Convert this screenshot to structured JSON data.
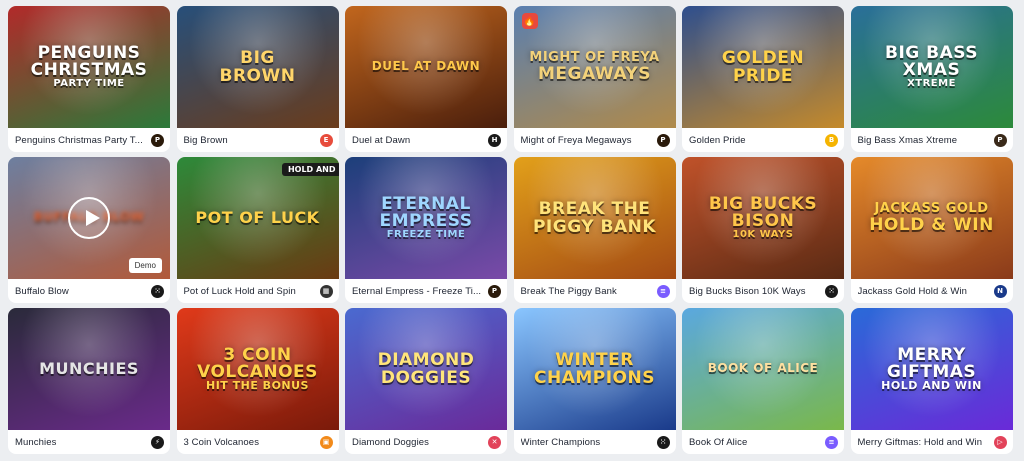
{
  "games": [
    {
      "title": "Penguins Christmas Party T...",
      "art": [
        "Penguins",
        "Christmas",
        "Party Time"
      ],
      "bg": [
        "#b22a2a",
        "#2b7a3a"
      ],
      "artColor": "#ffffff",
      "provider": {
        "icon": "play-n-go-icon",
        "glyph": "P",
        "color": "#2a1a0a"
      }
    },
    {
      "title": "Big Brown",
      "art": [
        "Big",
        "Brown"
      ],
      "bg": [
        "#274f7a",
        "#6a3c1c"
      ],
      "artColor": "#ffd56a",
      "provider": {
        "icon": "evoplay-icon",
        "glyph": "E",
        "color": "#e74c3c"
      }
    },
    {
      "title": "Duel at Dawn",
      "art": [
        "Duel at Dawn"
      ],
      "bg": [
        "#c1661d",
        "#4a1e0c"
      ],
      "artColor": "#ffc84a",
      "provider": {
        "icon": "hacksaw-icon",
        "glyph": "H",
        "color": "#1a1a1a"
      }
    },
    {
      "title": "Might of Freya Megaways",
      "art": [
        "Might of Freya",
        "Megaways"
      ],
      "bg": [
        "#5a7fb0",
        "#b08a4a"
      ],
      "artColor": "#f3d27a",
      "provider": {
        "icon": "play-n-go-icon",
        "glyph": "P",
        "color": "#2a1a0a"
      },
      "hot": "🔥"
    },
    {
      "title": "Golden Pride",
      "art": [
        "Golden",
        "Pride"
      ],
      "bg": [
        "#2e4f8e",
        "#c58a2a"
      ],
      "artColor": "#ffd24a",
      "provider": {
        "icon": "bgaming-icon",
        "glyph": "B",
        "color": "#f5b400"
      }
    },
    {
      "title": "Big Bass Xmas Xtreme",
      "art": [
        "Big Bass",
        "Xmas",
        "Xtreme"
      ],
      "bg": [
        "#2a6f9a",
        "#2c8a3a"
      ],
      "artColor": "#ffffff",
      "provider": {
        "icon": "pragmatic-icon",
        "glyph": "P",
        "color": "#3a2a1a"
      }
    },
    {
      "title": "Buffalo Blow",
      "art": [
        "Buffalo Blow"
      ],
      "bg": [
        "#6d7fa0",
        "#b25a3a"
      ],
      "artColor": "#e8683a",
      "provider": {
        "icon": "dots-grid-icon",
        "glyph": "⁙",
        "color": "#1a1a1a"
      },
      "blur": true,
      "demo": "Demo"
    },
    {
      "title": "Pot of Luck Hold and Spin",
      "art": [
        "Pot of Luck"
      ],
      "bg": [
        "#2d8a3a",
        "#6a3a12"
      ],
      "artColor": "#ffd24a",
      "provider": {
        "icon": "squares-icon",
        "glyph": "▦",
        "color": "#333333"
      },
      "hold": "HOLD AND"
    },
    {
      "title": "Eternal Empress - Freeze Ti...",
      "art": [
        "Eternal",
        "Empress",
        "Freeze Time"
      ],
      "bg": [
        "#1c3f7a",
        "#7a4aa8"
      ],
      "artColor": "#9fd6ff",
      "provider": {
        "icon": "play-n-go-icon",
        "glyph": "P",
        "color": "#2a1a0a"
      }
    },
    {
      "title": "Break The Piggy Bank",
      "art": [
        "Break The",
        "Piggy Bank"
      ],
      "bg": [
        "#e2a01a",
        "#a34a14"
      ],
      "artColor": "#ffe37a",
      "provider": {
        "icon": "layers-icon",
        "glyph": "≡",
        "color": "#7a5cff"
      }
    },
    {
      "title": "Big Bucks Bison 10K Ways",
      "art": [
        "Big Bucks",
        "Bison",
        "10K Ways"
      ],
      "bg": [
        "#c0522a",
        "#5a2a14"
      ],
      "artColor": "#ffc64a",
      "provider": {
        "icon": "dots-grid-icon",
        "glyph": "⁙",
        "color": "#1a1a1a"
      }
    },
    {
      "title": "Jackass Gold Hold & Win",
      "art": [
        "Jackass Gold",
        "Hold & Win"
      ],
      "bg": [
        "#e58a2a",
        "#8a3a1a"
      ],
      "artColor": "#ffd24a",
      "provider": {
        "icon": "netgame-icon",
        "glyph": "N",
        "color": "#1a3a8a"
      }
    },
    {
      "title": "Munchies",
      "art": [
        "Munchies"
      ],
      "bg": [
        "#2a2a3a",
        "#6a2a8a"
      ],
      "artColor": "#e5e5e5",
      "provider": {
        "icon": "bolt-icon",
        "glyph": "⚡",
        "color": "#1a1a1a"
      }
    },
    {
      "title": "3 Coin Volcanoes",
      "art": [
        "3 Coin",
        "Volcanoes",
        "Hit the Bonus"
      ],
      "bg": [
        "#e03a1a",
        "#7a1a0a"
      ],
      "artColor": "#ffd24a",
      "provider": {
        "icon": "orange-square-icon",
        "glyph": "▣",
        "color": "#f28a1a"
      }
    },
    {
      "title": "Diamond Doggies",
      "art": [
        "Diamond",
        "Doggies"
      ],
      "bg": [
        "#4a6ad0",
        "#6a2a9a"
      ],
      "artColor": "#ffe57a",
      "provider": {
        "icon": "bird-icon",
        "glyph": "✕",
        "color": "#e2435a"
      }
    },
    {
      "title": "Winter Champions",
      "art": [
        "Winter",
        "Champions"
      ],
      "bg": [
        "#8ac6ff",
        "#1a3a8a"
      ],
      "artColor": "#ffd24a",
      "provider": {
        "icon": "dots-grid-icon",
        "glyph": "⁙",
        "color": "#1a1a1a"
      }
    },
    {
      "title": "Book Of Alice",
      "art": [
        "Book of Alice"
      ],
      "bg": [
        "#5aa8e0",
        "#7ab84a"
      ],
      "artColor": "#ffe0a0",
      "provider": {
        "icon": "layers-icon",
        "glyph": "≡",
        "color": "#7a5cff"
      }
    },
    {
      "title": "Merry Giftmas: Hold and Win",
      "art": [
        "Merry",
        "Giftmas",
        "Hold and Win"
      ],
      "bg": [
        "#2a6ad8",
        "#6a2ad8"
      ],
      "artColor": "#ffffff",
      "provider": {
        "icon": "play-arrow-icon",
        "glyph": "▷",
        "color": "#e2435a"
      }
    }
  ]
}
